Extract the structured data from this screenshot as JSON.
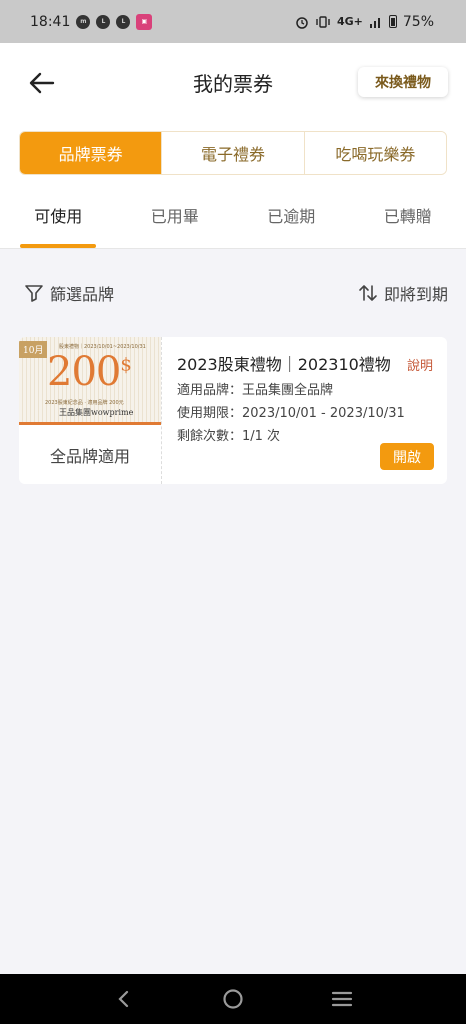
{
  "status_bar": {
    "time": "18:41",
    "network": "4G+",
    "battery": "75%"
  },
  "header": {
    "title": "我的票券",
    "exchange_label": "來換禮物"
  },
  "categories": [
    {
      "label": "品牌票券",
      "active": true
    },
    {
      "label": "電子禮券",
      "active": false
    },
    {
      "label": "吃喝玩樂券",
      "active": false
    }
  ],
  "status_tabs": [
    {
      "label": "可使用",
      "active": true
    },
    {
      "label": "已用畢",
      "active": false
    },
    {
      "label": "已逾期",
      "active": false
    },
    {
      "label": "已轉贈",
      "active": false
    }
  ],
  "filter": {
    "brand_label": "篩選品牌",
    "sort_label": "即將到期"
  },
  "coupon": {
    "thumb": {
      "month": "10月",
      "header": "股東禮物｜2023/10/01~2023/10/31",
      "amount": "200",
      "currency": "$",
      "note": "2023股東紀念品 · 適用品牌 200元",
      "brand": "王品集團wowprime"
    },
    "applicable_label": "全品牌適用",
    "title": "2023股東禮物｜202310禮物",
    "help_label": "說明",
    "brand_line": "適用品牌：王品集團全品牌",
    "period_line": "使用期限：2023/10/01 - 2023/10/31",
    "remaining_line": "剩餘次數：1/1 次",
    "open_label": "開啟"
  },
  "colors": {
    "accent": "#f39a0f",
    "brown": "#7a5a1c"
  }
}
